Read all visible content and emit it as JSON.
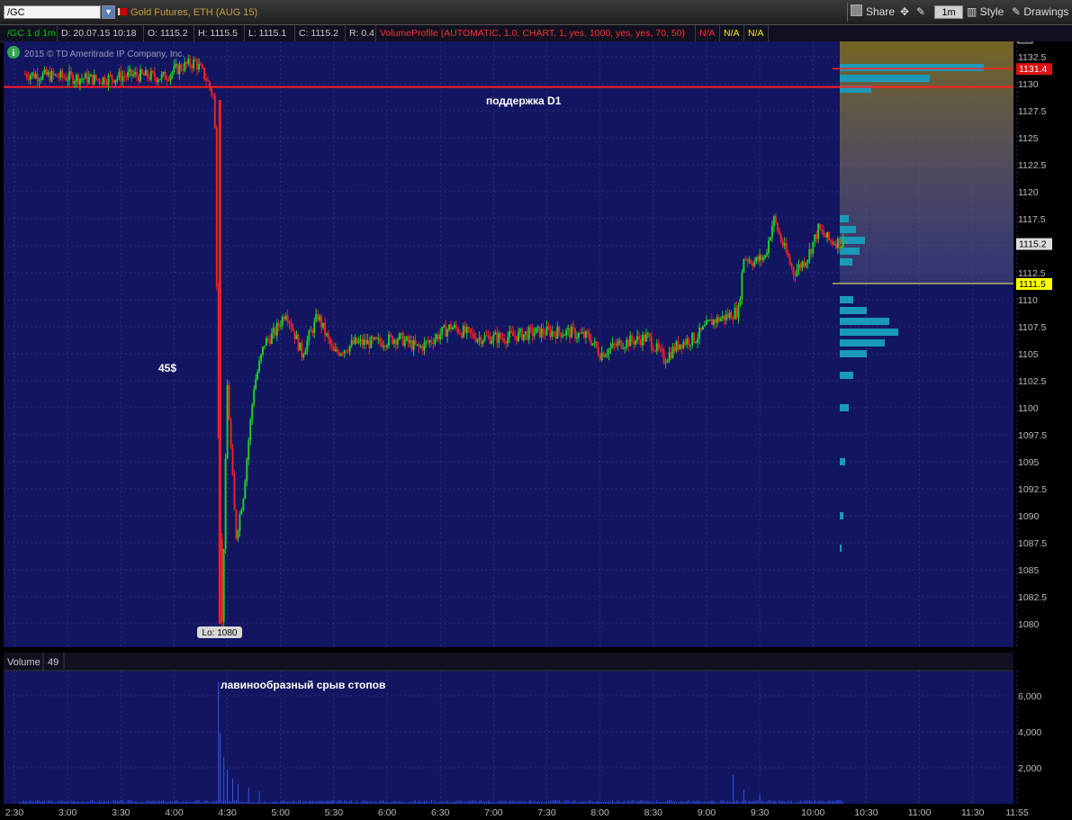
{
  "toolbar": {
    "symbol": "/GC",
    "description": "Gold Futures, ETH (AUG 15)",
    "share_label": "Share",
    "interval": "1m",
    "style_label": "Style",
    "drawings_label": "Drawings"
  },
  "info_bar": {
    "study": "/GC 1 d 1m",
    "date": "D: 20.07.15 10:18",
    "open": "O: 1115.2",
    "high": "H: 1115.5",
    "low": "L: 1115.1",
    "close": "C: 1115.2",
    "range": "R: 0.4",
    "volume_profile": "VolumeProfile (AUTOMATIC, 1.0, CHART, 1, yes, 1000, yes, yes, 70, 50)",
    "na1": "N/A",
    "na2": "N/A",
    "na3": "N/A"
  },
  "watermark": "2015 © TD Ameritrade IP Company, Inc.",
  "annotations": {
    "support": "поддержка D1",
    "drop": "45$",
    "stops": "лавинообразный срыв стопов"
  },
  "colors": {
    "up": "#22cc22",
    "down": "#ee2222",
    "support_line": "#ff2020",
    "last_price": "#ffff66",
    "profile": "#1a9ab8",
    "background": "#121560"
  },
  "chart_data": {
    "type": "candlestick",
    "y_ticks": [
      "1132.5",
      "1130",
      "1127.5",
      "1125",
      "1122.5",
      "1120",
      "1117.5",
      "1115",
      "1112.5",
      "1110",
      "1107.5",
      "1105",
      "1102.5",
      "1100",
      "1097.5",
      "1095",
      "1092.5",
      "1090",
      "1087.5",
      "1085",
      "1082.5",
      "1080"
    ],
    "x_ticks": [
      "2:30",
      "3:00",
      "3:30",
      "4:00",
      "4:30",
      "5:00",
      "5:30",
      "6:00",
      "6:30",
      "7:00",
      "7:30",
      "8:00",
      "8:30",
      "9:00",
      "9:30",
      "10:00",
      "10:30",
      "11:00",
      "11:30",
      "11:55"
    ],
    "price_labels": [
      {
        "text": "1131.4",
        "value": 1131.4,
        "color": "#dd1111"
      },
      {
        "text": "1115.2",
        "value": 1115.2,
        "color": "#dddddd"
      },
      {
        "text": "1111.5",
        "value": 1111.5,
        "color": "#ffff00"
      }
    ],
    "low_label": "Lo: 1080",
    "support_level": 1129.7,
    "price_path": [
      [
        2.6,
        1130.9
      ],
      [
        3.0,
        1130.6
      ],
      [
        3.3,
        1130.4
      ],
      [
        3.6,
        1130.8
      ],
      [
        3.9,
        1130.6
      ],
      [
        4.05,
        1131.5
      ],
      [
        4.2,
        1132.0
      ],
      [
        4.3,
        1130.5
      ],
      [
        4.38,
        1128.5
      ],
      [
        4.42,
        1095
      ],
      [
        4.45,
        1080
      ],
      [
        4.5,
        1102
      ],
      [
        4.58,
        1088
      ],
      [
        4.65,
        1092
      ],
      [
        4.75,
        1102
      ],
      [
        4.85,
        1106
      ],
      [
        4.95,
        1107
      ],
      [
        5.05,
        1109
      ],
      [
        5.2,
        1105
      ],
      [
        5.35,
        1108.5
      ],
      [
        5.5,
        1105
      ],
      [
        5.7,
        1106
      ],
      [
        5.9,
        1106
      ],
      [
        6.1,
        1106.5
      ],
      [
        6.3,
        1105.5
      ],
      [
        6.6,
        1107.5
      ],
      [
        6.85,
        1106.5
      ],
      [
        7.1,
        1106.5
      ],
      [
        7.4,
        1107
      ],
      [
        7.7,
        1107
      ],
      [
        7.9,
        1106.5
      ],
      [
        8.0,
        1105
      ],
      [
        8.2,
        1106
      ],
      [
        8.45,
        1106.5
      ],
      [
        8.6,
        1104.5
      ],
      [
        8.75,
        1106
      ],
      [
        8.9,
        1106.5
      ],
      [
        9.05,
        1108
      ],
      [
        9.2,
        1108.5
      ],
      [
        9.3,
        1109
      ],
      [
        9.35,
        1114
      ],
      [
        9.45,
        1113.5
      ],
      [
        9.55,
        1114
      ],
      [
        9.63,
        1117.5
      ],
      [
        9.72,
        1115
      ],
      [
        9.82,
        1112.5
      ],
      [
        9.95,
        1114
      ],
      [
        10.05,
        1116.5
      ],
      [
        10.15,
        1115.5
      ],
      [
        10.3,
        1115.2
      ]
    ],
    "volume": {
      "label": "Volume",
      "value_box": "49",
      "y_ticks": [
        "6,000",
        "4,000",
        "2,000"
      ],
      "spikes": [
        [
          4.42,
          6800
        ],
        [
          4.44,
          3900
        ],
        [
          4.46,
          2600
        ],
        [
          4.5,
          1900
        ],
        [
          4.55,
          1400
        ],
        [
          4.6,
          1100
        ],
        [
          4.7,
          900
        ],
        [
          4.8,
          700
        ],
        [
          9.25,
          1600
        ],
        [
          9.35,
          800
        ],
        [
          9.5,
          500
        ]
      ]
    },
    "profile": [
      [
        1131.5,
        160
      ],
      [
        1130.5,
        100
      ],
      [
        1129.5,
        35
      ],
      [
        1117.5,
        10
      ],
      [
        1116.5,
        18
      ],
      [
        1115.5,
        28
      ],
      [
        1114.5,
        22
      ],
      [
        1113.5,
        14
      ],
      [
        1110,
        15
      ],
      [
        1109,
        30
      ],
      [
        1108,
        55
      ],
      [
        1107,
        65
      ],
      [
        1106,
        50
      ],
      [
        1105,
        30
      ],
      [
        1103,
        15
      ],
      [
        1100,
        10
      ],
      [
        1095,
        6
      ],
      [
        1090,
        4
      ],
      [
        1087,
        2
      ]
    ]
  }
}
